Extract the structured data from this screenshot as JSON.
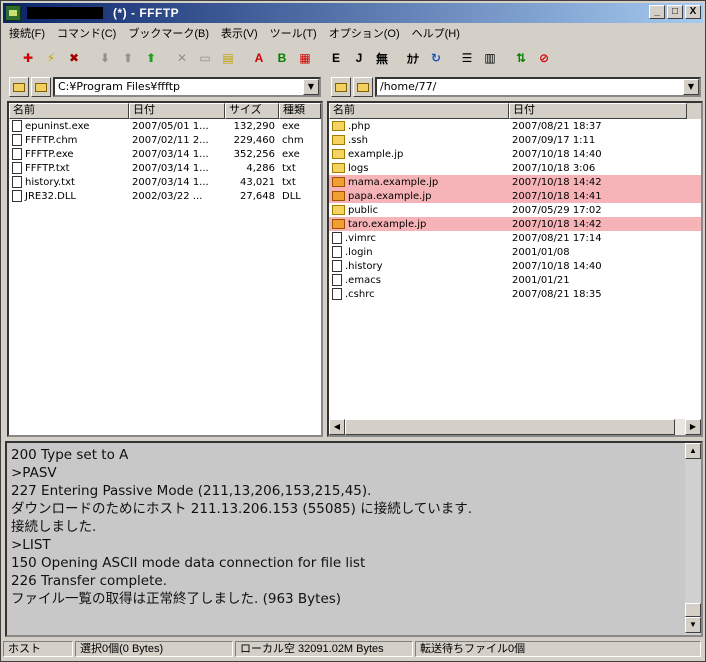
{
  "window": {
    "title": "(*) - FFFTP",
    "controls": {
      "minimize": "_",
      "maximize": "□",
      "close": "X"
    }
  },
  "menu": [
    "接続(F)",
    "コマンド(C)",
    "ブックマーク(B)",
    "表示(V)",
    "ツール(T)",
    "オプション(O)",
    "ヘルプ(H)"
  ],
  "toolbar": {
    "buttons": [
      {
        "name": "connect-icon",
        "glyph": "✚",
        "color": "#d00000"
      },
      {
        "name": "quick-connect-icon",
        "glyph": "⚡",
        "color": "#c0a000"
      },
      {
        "name": "disconnect-icon",
        "glyph": "✖",
        "color": "#a00000"
      },
      {
        "name": "download-icon",
        "glyph": "⬇",
        "color": "#909090"
      },
      {
        "name": "upload-icon",
        "glyph": "⬆",
        "color": "#909090"
      },
      {
        "name": "mirror-upload-icon",
        "glyph": "⬆",
        "color": "#20a020"
      },
      {
        "name": "delete-icon",
        "glyph": "✕",
        "color": "#909090"
      },
      {
        "name": "rename-icon",
        "glyph": "▭",
        "color": "#909090"
      },
      {
        "name": "new-folder-icon",
        "glyph": "▤",
        "color": "#c0a000"
      },
      {
        "name": "ascii-mode-icon",
        "glyph": "A",
        "color": "#d00000"
      },
      {
        "name": "binary-mode-icon",
        "glyph": "B",
        "color": "#008000"
      },
      {
        "name": "auto-mode-icon",
        "glyph": "▦",
        "color": "#d00000"
      },
      {
        "name": "euc-icon",
        "glyph": "E",
        "color": "#000000"
      },
      {
        "name": "jis-icon",
        "glyph": "J",
        "color": "#000000"
      },
      {
        "name": "no-convert-icon",
        "glyph": "無",
        "color": "#000000"
      },
      {
        "name": "kana-icon",
        "glyph": "ｶﾅ",
        "color": "#000000"
      },
      {
        "name": "refresh-icon",
        "glyph": "↻",
        "color": "#2050c0"
      },
      {
        "name": "list-view-icon",
        "glyph": "☰",
        "color": "#000000"
      },
      {
        "name": "detail-view-icon",
        "glyph": "▥",
        "color": "#000000"
      },
      {
        "name": "sync-icon",
        "glyph": "⇅",
        "color": "#008000"
      },
      {
        "name": "stop-icon",
        "glyph": "⊘",
        "color": "#d00000"
      }
    ]
  },
  "local": {
    "path": "C:¥Program Files¥ffftp",
    "columns": [
      "名前",
      "日付",
      "サイズ",
      "種類"
    ],
    "files": [
      {
        "name": "epuninst.exe",
        "date": "2007/05/01 1...",
        "size": "132,290",
        "type": "exe"
      },
      {
        "name": "FFFTP.chm",
        "date": "2007/02/11 2...",
        "size": "229,460",
        "type": "chm"
      },
      {
        "name": "FFFTP.exe",
        "date": "2007/03/14 1...",
        "size": "352,256",
        "type": "exe"
      },
      {
        "name": "FFFTP.txt",
        "date": "2007/03/14 1...",
        "size": "4,286",
        "type": "txt"
      },
      {
        "name": "history.txt",
        "date": "2007/03/14 1...",
        "size": "43,021",
        "type": "txt"
      },
      {
        "name": "JRE32.DLL",
        "date": "2002/03/22 ...",
        "size": "27,648",
        "type": "DLL"
      }
    ]
  },
  "remote": {
    "path": "/home/77/",
    "columns": [
      "名前",
      "日付"
    ],
    "files": [
      {
        "name": ".php",
        "date": "2007/08/21 18:37",
        "kind": "folder",
        "hl": false
      },
      {
        "name": ".ssh",
        "date": "2007/09/17  1:11",
        "kind": "folder",
        "hl": false
      },
      {
        "name": "example.jp",
        "date": "2007/10/18 14:40",
        "kind": "folder",
        "hl": false
      },
      {
        "name": "logs",
        "date": "2007/10/18  3:06",
        "kind": "folder",
        "hl": false
      },
      {
        "name": "mama.example.jp",
        "date": "2007/10/18 14:42",
        "kind": "folder",
        "hl": true
      },
      {
        "name": "papa.example.jp",
        "date": "2007/10/18 14:41",
        "kind": "folder",
        "hl": true
      },
      {
        "name": "public",
        "date": "2007/05/29 17:02",
        "kind": "folder",
        "hl": false
      },
      {
        "name": "taro.example.jp",
        "date": "2007/10/18 14:42",
        "kind": "folder",
        "hl": true
      },
      {
        "name": ".vimrc",
        "date": "2007/08/21 17:14",
        "kind": "file",
        "hl": false
      },
      {
        "name": ".login",
        "date": "2001/01/08",
        "kind": "file",
        "hl": false
      },
      {
        "name": ".history",
        "date": "2007/10/18 14:40",
        "kind": "file",
        "hl": false
      },
      {
        "name": ".emacs",
        "date": "2001/01/21",
        "kind": "file",
        "hl": false
      },
      {
        "name": ".cshrc",
        "date": "2007/08/21 18:35",
        "kind": "file",
        "hl": false
      }
    ]
  },
  "log": [
    "200 Type set to A",
    ">PASV",
    "227 Entering Passive Mode (211,13,206,153,215,45).",
    "ダウンロードのためにホスト 211.13.206.153 (55085) に接続しています.",
    "接続しました.",
    ">LIST",
    "150 Opening ASCII mode data connection for file list",
    "226 Transfer complete.",
    "ファイル一覧の取得は正常終了しました. (963 Bytes)"
  ],
  "status": {
    "host": "ホスト",
    "selected": "選択0個(0 Bytes)",
    "local_free": "ローカル空 32091.02M Bytes",
    "queue": "転送待ちファイル0個"
  },
  "colors": {
    "highlight": "#f7b4b8",
    "title_start": "#0a246a",
    "title_end": "#a6caf0"
  }
}
